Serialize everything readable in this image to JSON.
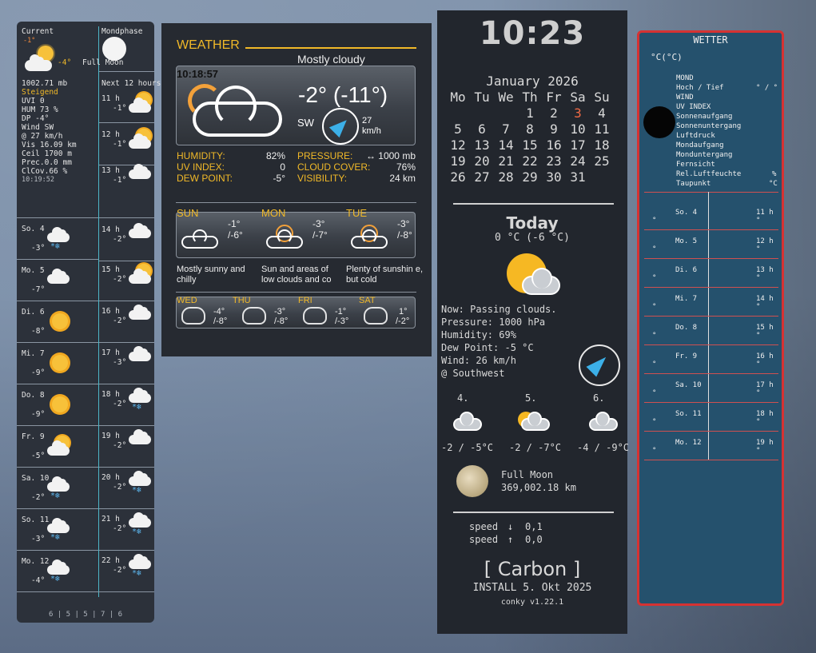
{
  "left": {
    "current_label": "Current",
    "current_temp": "-1°",
    "current_feels": "-4°",
    "moonphase_label": "Mondphase",
    "moon_text": "Full Moon",
    "next12_label": "Next 12 hours",
    "details": [
      "1002.71 mb",
      "Steigend",
      "UVI 0",
      "HUM 73 %",
      "DP  -4°",
      "Wind SW",
      "@ 27 km/h",
      "Vis 16.09 km",
      "Ceil 1700 m",
      "Prec.0.0 mm",
      "ClCov.66 %",
      "10:19:52"
    ],
    "hours": [
      {
        "h": "11 h",
        "t": "-1°",
        "icon": "partly-cloudy-icon"
      },
      {
        "h": "12 h",
        "t": "-1°",
        "icon": "partly-cloudy-icon"
      },
      {
        "h": "13 h",
        "t": "-1°",
        "icon": "cloud-icon"
      },
      {
        "h": "14 h",
        "t": "-2°",
        "icon": "cloud-icon"
      },
      {
        "h": "15 h",
        "t": "-2°",
        "icon": "partly-cloudy-icon"
      },
      {
        "h": "16 h",
        "t": "-2°",
        "icon": "cloud-icon"
      },
      {
        "h": "17 h",
        "t": "-3°",
        "icon": "cloud-icon"
      },
      {
        "h": "18 h",
        "t": "-2°",
        "icon": "snow-cloud-icon"
      },
      {
        "h": "19 h",
        "t": "-2°",
        "icon": "cloud-icon"
      },
      {
        "h": "20 h",
        "t": "-2°",
        "icon": "snow-cloud-icon"
      },
      {
        "h": "21 h",
        "t": "-2°",
        "icon": "snow-cloud-icon"
      },
      {
        "h": "22 h",
        "t": "-2°",
        "icon": "snow-cloud-icon"
      }
    ],
    "days": [
      {
        "d": "So.  4",
        "t": "-3°",
        "icon": "snow-cloud-icon"
      },
      {
        "d": "Mo.  5",
        "t": "-7°",
        "icon": "cloud-icon"
      },
      {
        "d": "Di.  6",
        "t": "-8°",
        "icon": "sun-icon"
      },
      {
        "d": "Mi.  7",
        "t": "-9°",
        "icon": "sun-icon"
      },
      {
        "d": "Do.  8",
        "t": "-9°",
        "icon": "sun-icon"
      },
      {
        "d": "Fr.  9",
        "t": "-5°",
        "icon": "partly-cloudy-icon"
      },
      {
        "d": "Sa. 10",
        "t": "-2°",
        "icon": "snow-cloud-icon"
      },
      {
        "d": "So. 11",
        "t": "-3°",
        "icon": "snow-cloud-icon"
      },
      {
        "d": "Mo. 12",
        "t": "-4°",
        "icon": "snow-cloud-icon"
      }
    ],
    "footer": "6 | 5 | 5 | 7 | 6"
  },
  "weather": {
    "title": "WEATHER",
    "condition": "Mostly cloudy",
    "time": "10:18:57",
    "temp": "-2° (-11°)",
    "wind_dir": "SW",
    "wind_speed": "27",
    "wind_unit": "km/h",
    "stats_left": [
      [
        "HUMIDITY:",
        "82%"
      ],
      [
        "UV INDEX:",
        "0"
      ],
      [
        "DEW POINT:",
        "-5°"
      ]
    ],
    "stats_right": [
      [
        "PRESSURE:",
        "↔ 1000 mb"
      ],
      [
        "CLOUD COVER:",
        "76%"
      ],
      [
        "VISIBILITY:",
        "24 km"
      ]
    ],
    "forecast": [
      {
        "day": "SUN",
        "hi": "-1°",
        "lo": "/-6°",
        "desc": "Mostly sunny and chilly"
      },
      {
        "day": "MON",
        "hi": "-3°",
        "lo": "/-7°",
        "desc": "Sun and areas of low clouds and co"
      },
      {
        "day": "TUE",
        "hi": "-3°",
        "lo": "/-8°",
        "desc": "Plenty of sunshin e, but cold"
      }
    ],
    "small": [
      {
        "day": "WED",
        "hi": "-4°",
        "lo": "/-8°"
      },
      {
        "day": "THU",
        "hi": "-3°",
        "lo": "/-8°"
      },
      {
        "day": "FRI",
        "hi": "-1°",
        "lo": "/-3°"
      },
      {
        "day": "SAT",
        "hi": "1°",
        "lo": "/-2°"
      }
    ]
  },
  "carbon": {
    "clock": "10:23",
    "month": "January 2026",
    "weekdays": [
      "Mo",
      "Tu",
      "We",
      "Th",
      "Fr",
      "Sa",
      "Su"
    ],
    "weeks": [
      [
        "",
        "",
        "",
        "1",
        "2",
        "3",
        "4"
      ],
      [
        "5",
        "6",
        "7",
        "8",
        "9",
        "10",
        "11"
      ],
      [
        "12",
        "13",
        "14",
        "15",
        "16",
        "17",
        "18"
      ],
      [
        "19",
        "20",
        "21",
        "22",
        "23",
        "24",
        "25"
      ],
      [
        "26",
        "27",
        "28",
        "29",
        "30",
        "31",
        ""
      ]
    ],
    "today_label": "Today",
    "today_temp": "0 °C  (-6 °C)",
    "details": [
      "Now: Passing clouds.",
      "Pressure: 1000 hPa",
      "Humidity: 69%",
      "Dew Point: -5 °C",
      "Wind: 26 km/h",
      "@ Southwest"
    ],
    "forecast": [
      {
        "day": "4.",
        "temp": "-2 / -5°C"
      },
      {
        "day": "5.",
        "temp": "-2 / -7°C"
      },
      {
        "day": "6.",
        "temp": "-4 / -9°C"
      }
    ],
    "moon_phase": "Full Moon",
    "moon_dist": "369,002.18 km",
    "speed_down_label": "speed",
    "speed_down": "0,1",
    "speed_up_label": "speed",
    "speed_up": "0,0",
    "brand": "[ Carbon ]",
    "install": "INSTALL 5. Okt 2025",
    "version": "conky v1.22.1",
    "colors": {
      "today_red": "#f06a45",
      "sun": "#f6b823"
    }
  },
  "wetter": {
    "title": "WETTER",
    "unit": "°C(°C)",
    "labels": [
      "MOND",
      "Hoch / Tief",
      "WIND",
      "UV INDEX",
      "Sonnenaufgang",
      "Sonnenuntergang",
      "Luftdruck",
      "Mondaufgang",
      "Monduntergang",
      "Fernsicht",
      "Rel.Luftfeuchte",
      "Taupunkt"
    ],
    "hochtief_val": "° / °",
    "luft_unit": "%",
    "tau_unit": "°C",
    "rows": [
      {
        "d": "So.  4",
        "h": "11 h"
      },
      {
        "d": "Mo.  5",
        "h": "12 h"
      },
      {
        "d": "Di.  6",
        "h": "13 h"
      },
      {
        "d": "Mi.  7",
        "h": "14 h"
      },
      {
        "d": "Do.  8",
        "h": "15 h"
      },
      {
        "d": "Fr.  9",
        "h": "16 h"
      },
      {
        "d": "Sa. 10",
        "h": "17 h"
      },
      {
        "d": "So. 11",
        "h": "18 h"
      },
      {
        "d": "Mo. 12",
        "h": "19 h"
      }
    ],
    "deg": "°"
  }
}
